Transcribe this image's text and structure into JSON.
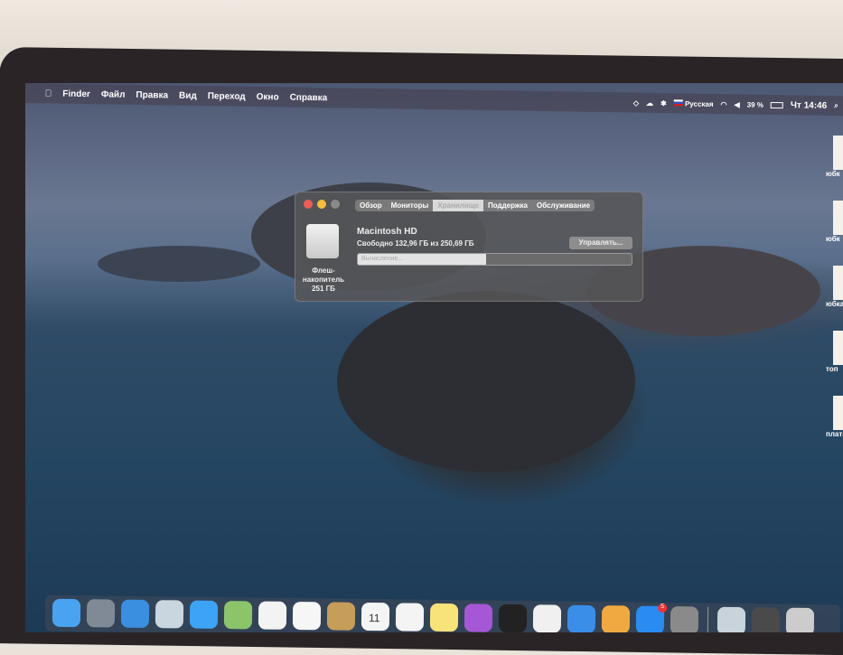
{
  "menubar": {
    "apple": "",
    "items": [
      "Finder",
      "Файл",
      "Правка",
      "Вид",
      "Переход",
      "Окно",
      "Справка"
    ],
    "status": {
      "input_source": "Русская",
      "battery": "39 %",
      "clock": "Чт 14:46"
    }
  },
  "about_window": {
    "tabs": [
      "Обзор",
      "Мониторы",
      "Хранилище",
      "Поддержка",
      "Обслуживание"
    ],
    "active_tab": "Хранилище",
    "drive_label": "Флеш-накопитель 251 ГБ",
    "volume_name": "Macintosh HD",
    "free_text": "Свободно 132,96 ГБ из 250,69 ГБ",
    "manage_button": "Управлять...",
    "bar_text": "Вычисление...",
    "used_fraction": 0.47
  },
  "desktop_icons": [
    "юбк",
    "юбк",
    "юбка",
    "топ",
    "плать"
  ],
  "dock": [
    "finder-icon",
    "launchpad-icon",
    "safari-icon",
    "mail-icon",
    "messages-icon",
    "maps-icon",
    "photos-icon",
    "music-icon",
    "contacts-icon",
    "calendar-icon",
    "reminders-icon",
    "notes-icon",
    "podcasts-icon",
    "tv-icon",
    "numbers-icon",
    "keynote-icon",
    "pages-icon",
    "app-store-icon",
    "system-preferences-icon",
    "preview-icon",
    "activity-monitor-icon",
    "script-editor-icon"
  ],
  "calendar_day": "11",
  "app_store_badge": "5"
}
